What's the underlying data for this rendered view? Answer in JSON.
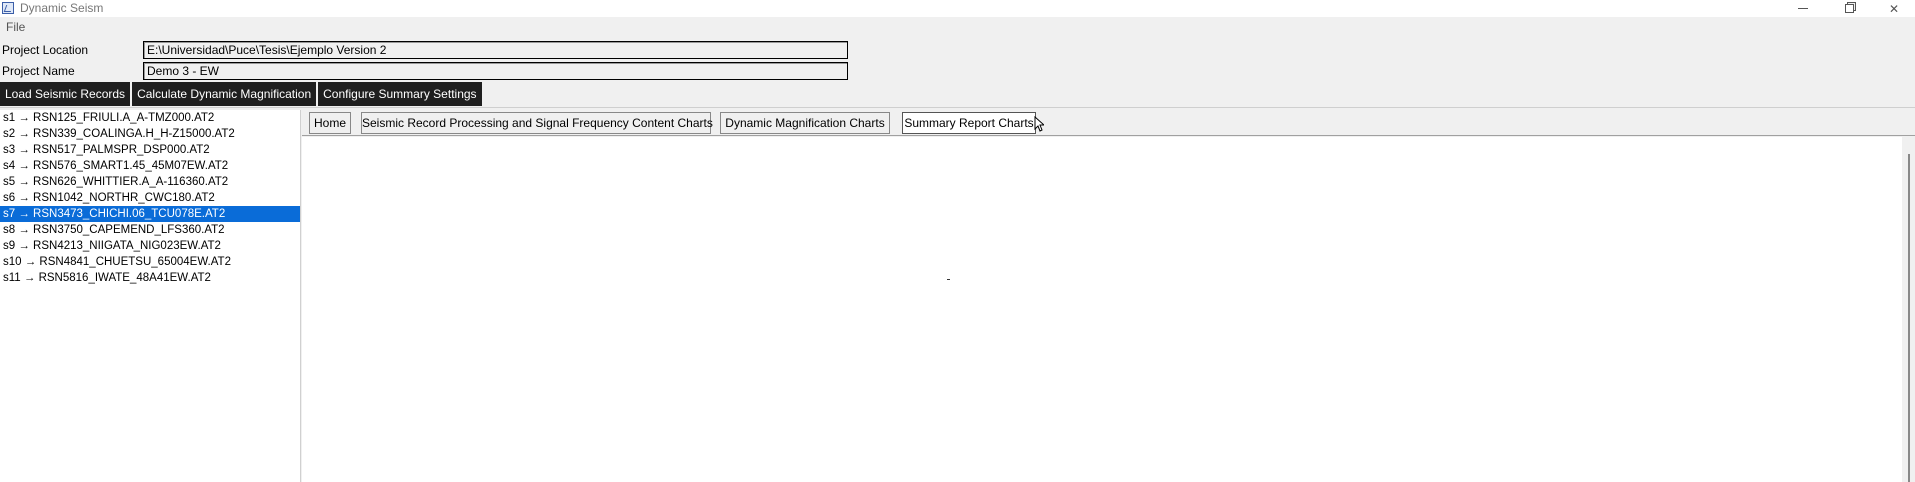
{
  "window": {
    "title": "Dynamic Seism"
  },
  "menu": {
    "file": "File"
  },
  "project": {
    "location_label": "Project Location",
    "location_value": "E:\\Universidad\\Puce\\Tesis\\Ejemplo Version 2",
    "name_label": "Project Name",
    "name_value": "Demo 3 - EW"
  },
  "toolbar": {
    "load_label": "Load Seismic Records",
    "calc_label": "Calculate Dynamic Magnification",
    "config_label": "Configure Summary Settings"
  },
  "records": [
    "s1 → RSN125_FRIULI.A_A-TMZ000.AT2",
    "s2 → RSN339_COALINGA.H_H-Z15000.AT2",
    "s3 → RSN517_PALMSPR_DSP000.AT2",
    "s4 → RSN576_SMART1.45_45M07EW.AT2",
    "s5 → RSN626_WHITTIER.A_A-116360.AT2",
    "s6 → RSN1042_NORTHR_CWC180.AT2",
    "s7 → RSN3473_CHICHI.06_TCU078E.AT2",
    "s8 → RSN3750_CAPEMEND_LFS360.AT2",
    "s9 → RSN4213_NIIGATA_NIG023EW.AT2",
    "s10 → RSN4841_CHUETSU_65004EW.AT2",
    "s11 → RSN5816_IWATE_48A41EW.AT2"
  ],
  "selected_record_index": 6,
  "tabs": {
    "home": "Home",
    "processing": "Seismic Record Processing and Signal Frequency Content Charts",
    "magnification": "Dynamic Magnification Charts",
    "summary": "Summary Report Charts"
  },
  "active_tab": "summary",
  "colors": {
    "selection": "#0a6cd8",
    "toolbar_button": "#1f1f1f"
  }
}
